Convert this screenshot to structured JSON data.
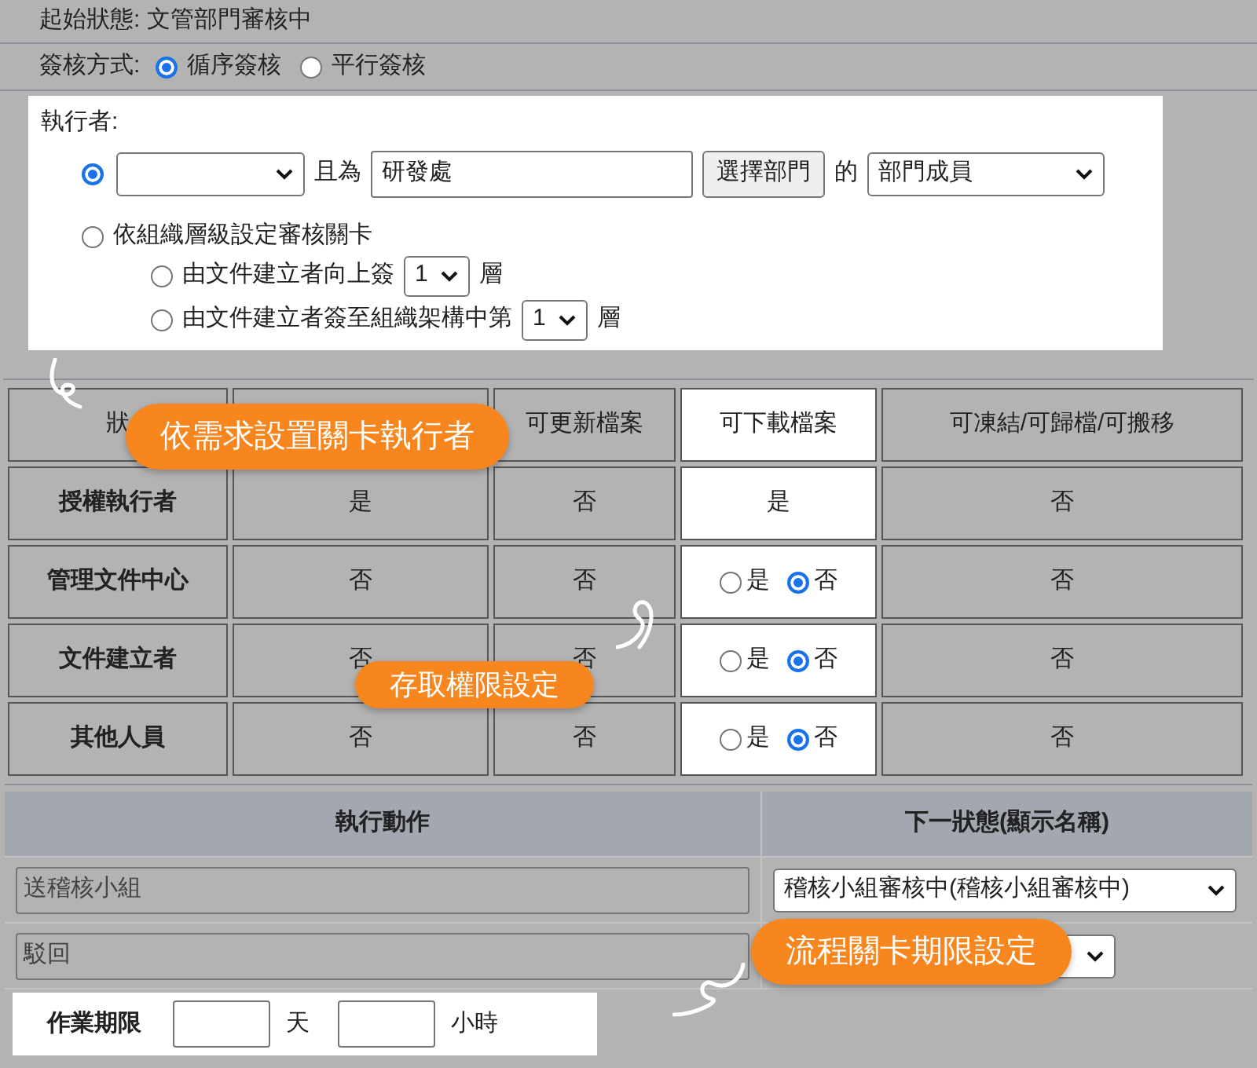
{
  "status_line": {
    "text": "起始狀態: 文管部門審核中"
  },
  "sign_mode": {
    "label": "簽核方式:",
    "options": [
      {
        "label": "循序簽核",
        "selected": true
      },
      {
        "label": "平行簽核",
        "selected": false
      }
    ]
  },
  "executor": {
    "label": "執行者:",
    "options": [
      {
        "kind": "department",
        "selected": true,
        "joiner": "且為",
        "department": "研發處",
        "button": "選擇部門",
        "of": "的",
        "member_select": "部門成員"
      },
      {
        "kind": "org_level",
        "selected": false,
        "label": "依組織層級設定審核關卡",
        "sub_options": [
          {
            "selected": false,
            "prefix": "由文件建立者向上簽",
            "count": "1",
            "suffix": "層"
          },
          {
            "selected": false,
            "prefix": "由文件建立者簽至組織架構中第",
            "count": "1",
            "suffix": "層"
          }
        ]
      }
    ]
  },
  "permissions": {
    "columns": [
      {
        "label": "狀",
        "highlighted": false
      },
      {
        "highlighted": false
      },
      {
        "label": "可更新檔案",
        "highlighted": false
      },
      {
        "label": "可下載檔案",
        "highlighted": true
      },
      {
        "label": "可凍結/可歸檔/可搬移",
        "highlighted": false
      }
    ],
    "rows": [
      {
        "cells": [
          {
            "kind": "role",
            "text": "授權執行者"
          },
          {
            "kind": "text",
            "text": "是"
          },
          {
            "kind": "text",
            "text": "否"
          },
          {
            "kind": "text",
            "text": "是"
          },
          {
            "kind": "text",
            "text": "否"
          }
        ]
      },
      {
        "cells": [
          {
            "kind": "role",
            "text": "管理文件中心"
          },
          {
            "kind": "text",
            "text": "否"
          },
          {
            "kind": "text",
            "text": "否"
          },
          {
            "kind": "radio",
            "options": [
              {
                "label": "是",
                "selected": false
              },
              {
                "label": "否",
                "selected": true
              }
            ]
          },
          {
            "kind": "text",
            "text": "否"
          }
        ]
      },
      {
        "cells": [
          {
            "kind": "role",
            "text": "文件建立者"
          },
          {
            "kind": "text",
            "text": "否"
          },
          {
            "kind": "text",
            "text": "否"
          },
          {
            "kind": "radio",
            "options": [
              {
                "label": "是",
                "selected": false
              },
              {
                "label": "否",
                "selected": true
              }
            ]
          },
          {
            "kind": "text",
            "text": "否"
          }
        ]
      },
      {
        "cells": [
          {
            "kind": "role",
            "text": "其他人員"
          },
          {
            "kind": "text",
            "text": "否"
          },
          {
            "kind": "text",
            "text": "否"
          },
          {
            "kind": "radio",
            "options": [
              {
                "label": "是",
                "selected": false
              },
              {
                "label": "否",
                "selected": true
              }
            ]
          },
          {
            "kind": "text",
            "text": "否"
          }
        ]
      }
    ]
  },
  "actions": {
    "columns": [
      "執行動作",
      "下一狀態(顯示名稱)"
    ],
    "rows": [
      {
        "action": "送稽核小組",
        "next_state": "稽核小組審核中(稽核小組審核中)"
      },
      {
        "action": "駁回"
      }
    ]
  },
  "deadline": {
    "label": "作業期限",
    "day_unit": "天",
    "hour_unit": "小時"
  },
  "callouts": [
    {
      "text": "依需求設置關卡執行者"
    },
    {
      "text": "存取權限設定"
    },
    {
      "text": "流程關卡期限設定"
    }
  ]
}
